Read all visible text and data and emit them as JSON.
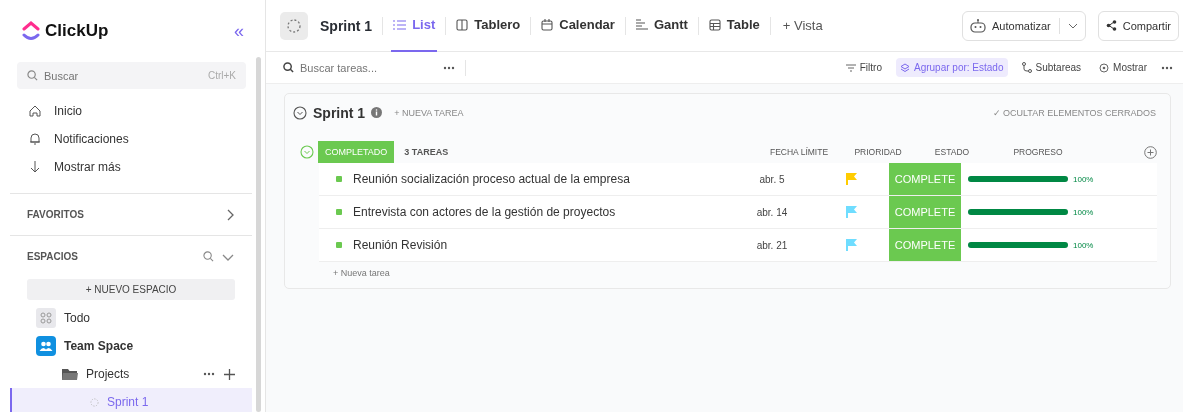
{
  "sidebar": {
    "logo": "ClickUp",
    "collapse": "«",
    "search": {
      "placeholder": "Buscar",
      "shortcut": "Ctrl+K"
    },
    "nav": [
      {
        "label": "Inicio",
        "kind": "home"
      },
      {
        "label": "Notificaciones",
        "kind": "bell"
      },
      {
        "label": "Mostrar más",
        "kind": "down"
      }
    ],
    "favorites": {
      "title": "FAVORITOS",
      "expanded": false
    },
    "spaces": {
      "title": "ESPACIOS",
      "expanded": true,
      "new_button": "+ NUEVO ESPACIO",
      "items": [
        {
          "label": "Todo",
          "kind": "all",
          "selected": false
        },
        {
          "label": "Team Space",
          "kind": "team",
          "selected": false,
          "children": [
            {
              "label": "Projects",
              "kind": "folder",
              "selected": false,
              "children": [
                {
                  "label": "Sprint 1",
                  "kind": "list",
                  "selected": true
                }
              ]
            }
          ]
        }
      ]
    }
  },
  "header": {
    "title": "Sprint 1",
    "tabs": [
      {
        "label": "List",
        "kind": "list",
        "selected": true
      },
      {
        "label": "Tablero",
        "kind": "board",
        "selected": false
      },
      {
        "label": "Calendar",
        "kind": "calendar",
        "selected": false
      },
      {
        "label": "Gantt",
        "kind": "gantt",
        "selected": false
      },
      {
        "label": "Table",
        "kind": "table",
        "selected": false
      }
    ],
    "add_view": "+ Vista",
    "automate": "Automatizar",
    "share": "Compartir"
  },
  "toolbar": {
    "search": {
      "placeholder": "Buscar tareas..."
    },
    "filter": "Filtro",
    "group_by": "Agrupar por: Estado",
    "subtasks": "Subtareas",
    "show": "Mostrar"
  },
  "list": {
    "title": "Sprint 1",
    "new_task": "+ NUEVA TAREA",
    "hide_closed": "✓ OCULTAR ELEMENTOS CERRADOS",
    "group": {
      "status": "COMPLETADO",
      "count": "3 TAREAS",
      "expanded": true,
      "columns": [
        "FECHA LÍMITE",
        "PRIORIDAD",
        "ESTADO",
        "PROGRESO"
      ],
      "rows": [
        {
          "name": "Reunión socialización proceso actual de la empresa",
          "due": "abr. 5",
          "color": "#ffcc00",
          "status": "COMPLETE",
          "level": 1,
          "percent": "100%"
        },
        {
          "name": "Entrevista con actores de la gestión de proyectos",
          "due": "abr. 14",
          "color": "#6fddff",
          "status": "COMPLETE",
          "level": 1,
          "percent": "100%"
        },
        {
          "name": "Reunión Revisión",
          "due": "abr. 21",
          "color": "#6fddff",
          "status": "COMPLETE",
          "level": 1,
          "percent": "100%"
        }
      ],
      "add_task": "+ Nueva tarea"
    }
  }
}
